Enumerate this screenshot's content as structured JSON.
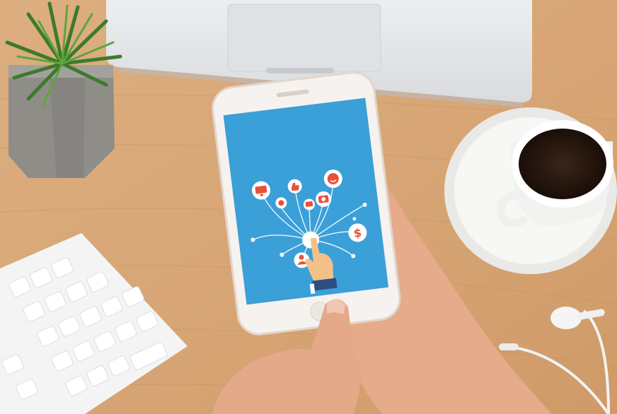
{
  "scene": {
    "description_objects": [
      "desk",
      "laptop",
      "plant",
      "phone",
      "coffee-cup",
      "keyboard",
      "earphone",
      "hands"
    ],
    "colors": {
      "desk": "#d9a878",
      "desk_dark": "#c48f5e",
      "laptop": "#e8e9eb",
      "screen_bg": "#3b9fd8",
      "icon_red": "#e8503a",
      "phone_body": "#f4f1ee",
      "skin": "#e9b08f",
      "coffee": "#2a1a12"
    },
    "phone_screen_icons": [
      "monitor-icon",
      "thumbs-up-icon",
      "smiley-icon",
      "camera-icon",
      "dollar-icon",
      "user-icon",
      "heart-icon",
      "mail-icon"
    ]
  }
}
